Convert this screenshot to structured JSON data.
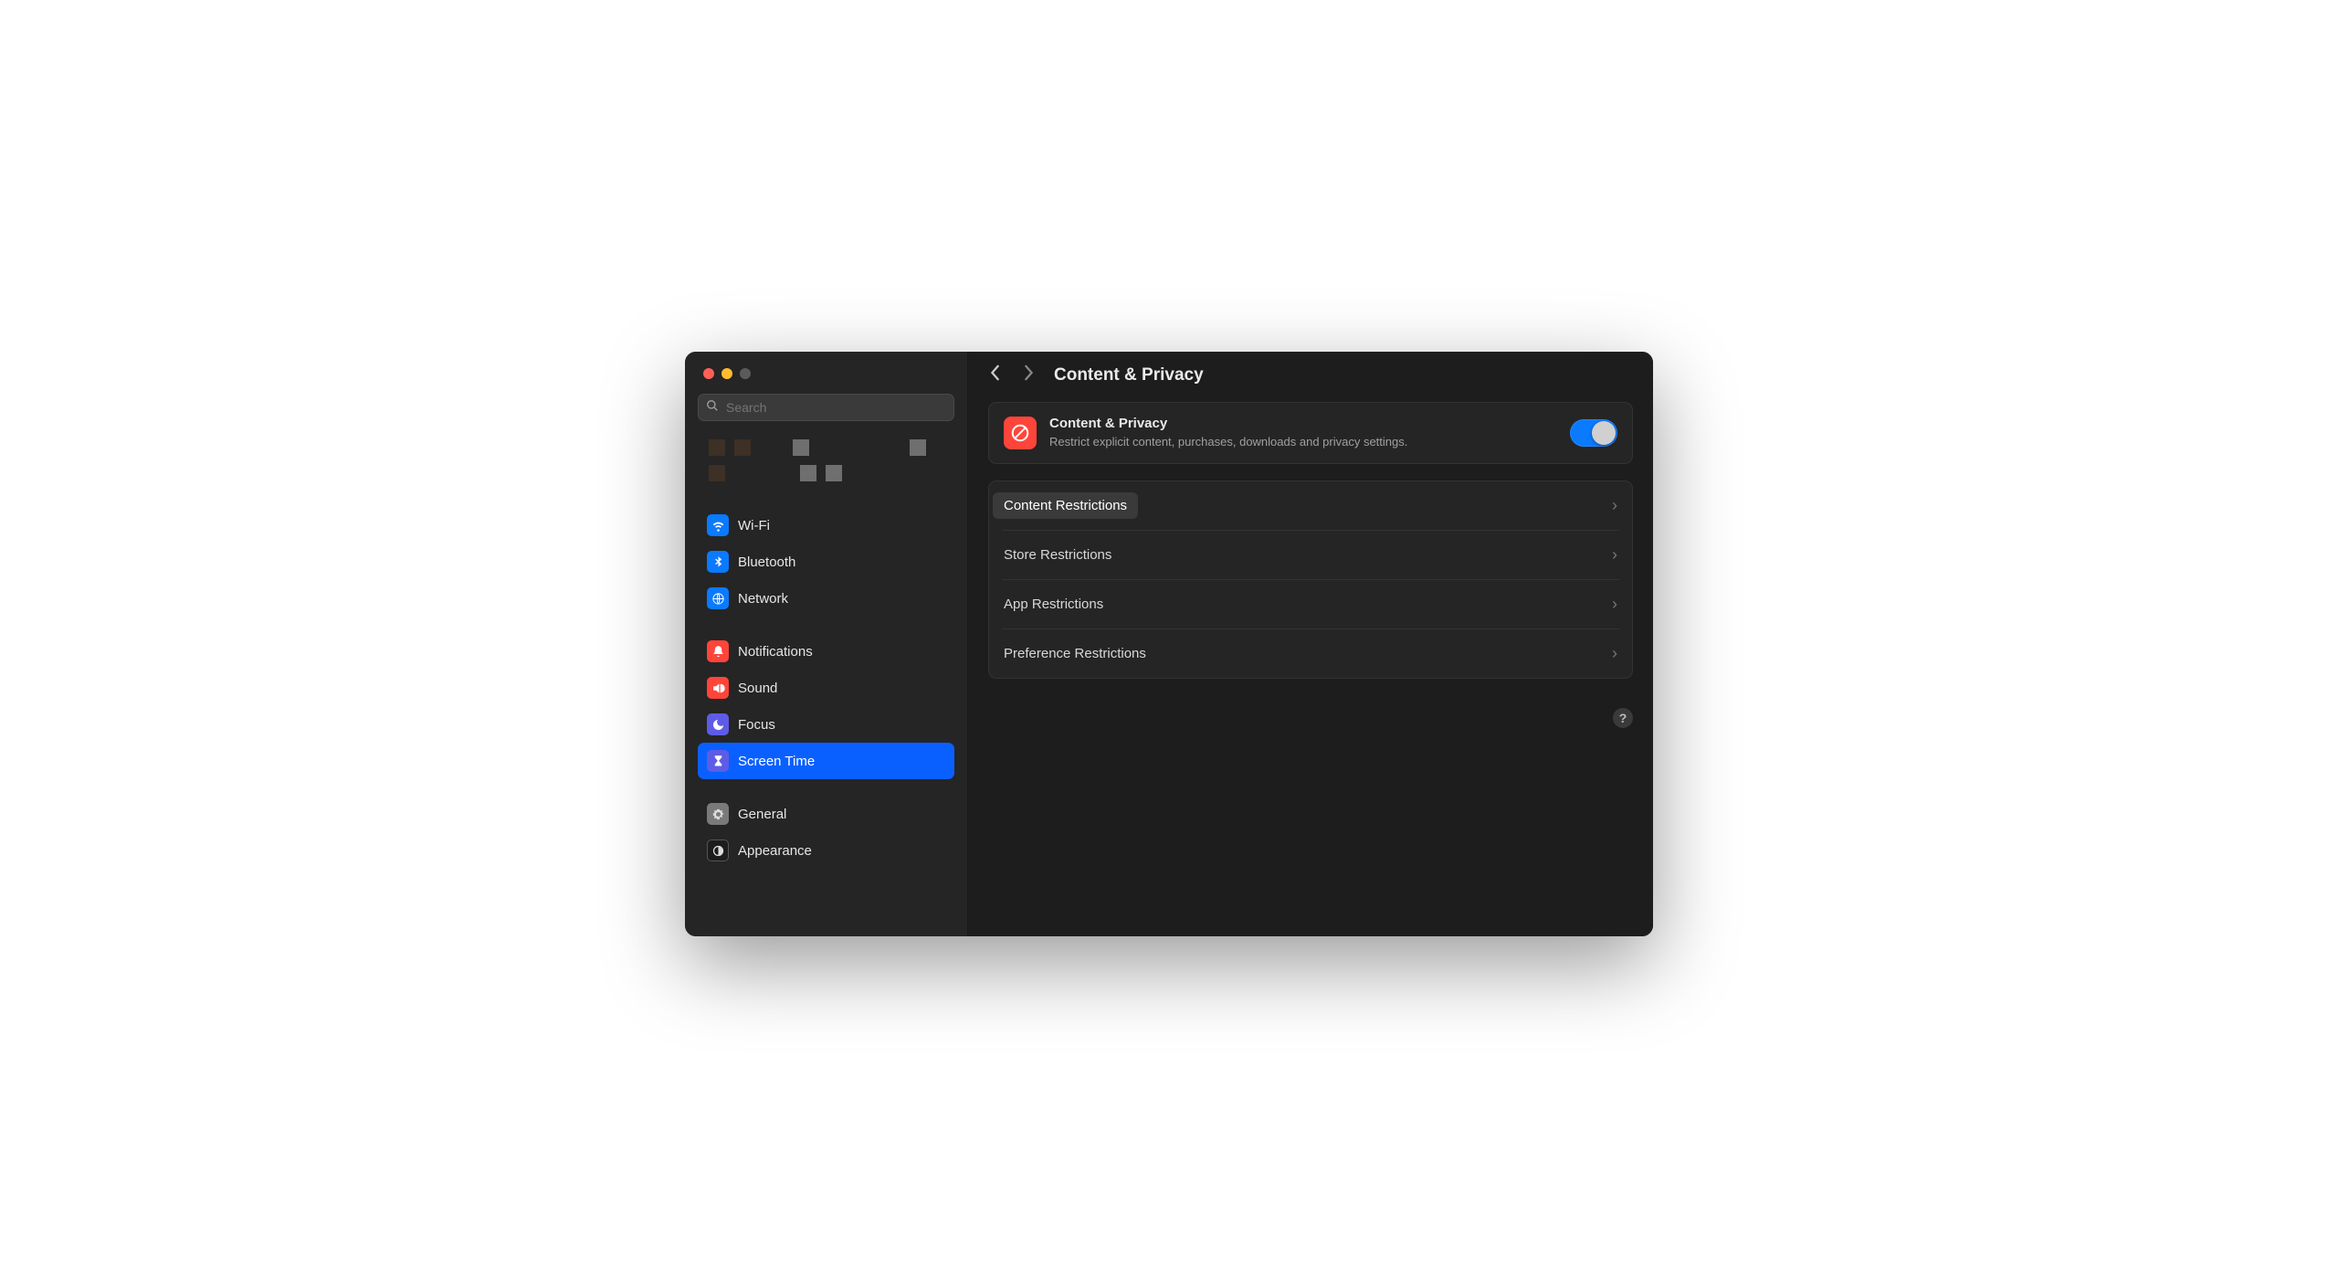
{
  "search": {
    "placeholder": "Search"
  },
  "sidebar": {
    "items": [
      {
        "label": "Wi-Fi"
      },
      {
        "label": "Bluetooth"
      },
      {
        "label": "Network"
      },
      {
        "label": "Notifications"
      },
      {
        "label": "Sound"
      },
      {
        "label": "Focus"
      },
      {
        "label": "Screen Time"
      },
      {
        "label": "General"
      },
      {
        "label": "Appearance"
      }
    ]
  },
  "header": {
    "title": "Content & Privacy"
  },
  "main_panel": {
    "title": "Content & Privacy",
    "description": "Restrict explicit content, purchases, downloads and privacy settings.",
    "toggle_on": true
  },
  "restriction_items": [
    {
      "label": "Content Restrictions"
    },
    {
      "label": "Store Restrictions"
    },
    {
      "label": "App Restrictions"
    },
    {
      "label": "Preference Restrictions"
    }
  ],
  "help": {
    "label": "?"
  }
}
